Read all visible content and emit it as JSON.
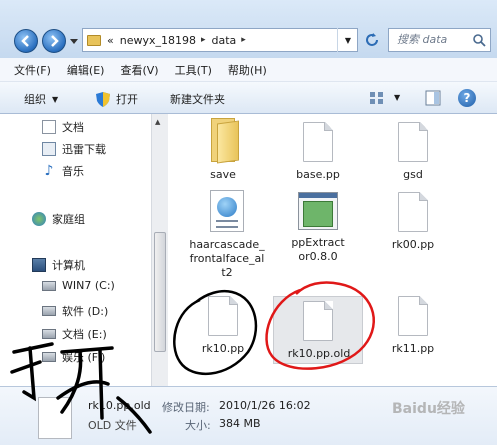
{
  "address": {
    "prefix": "«",
    "path": [
      "newyx_18198",
      "data"
    ],
    "separator": "▸",
    "search_placeholder": "搜索 data"
  },
  "menu": [
    "文件(F)",
    "编辑(E)",
    "查看(V)",
    "工具(T)",
    "帮助(H)"
  ],
  "toolbar": {
    "organize": "组织",
    "open": "打开",
    "new_folder": "新建文件夹",
    "help": "?"
  },
  "nav": {
    "items": [
      {
        "label": "文档",
        "icon": "documents-icon"
      },
      {
        "label": "迅雷下载",
        "icon": "downloads-icon"
      },
      {
        "label": "音乐",
        "icon": "music-icon"
      },
      {
        "label": "家庭组",
        "icon": "homegroup-icon"
      },
      {
        "label": "计算机",
        "icon": "computer-icon"
      },
      {
        "label": "WIN7 (C:)",
        "icon": "drive-icon"
      },
      {
        "label": "软件 (D:)",
        "icon": "drive-icon"
      },
      {
        "label": "文档 (E:)",
        "icon": "drive-icon"
      },
      {
        "label": "娱乐 (F:)",
        "icon": "drive-icon"
      }
    ]
  },
  "files": [
    {
      "name": "save",
      "kind": "folder"
    },
    {
      "name": "base.pp",
      "kind": "doc"
    },
    {
      "name": "gsd",
      "kind": "doc"
    },
    {
      "name": "haarcascade_frontalface_alt2",
      "kind": "xml"
    },
    {
      "name": "ppExtractor0.8.0",
      "kind": "exe"
    },
    {
      "name": "rk00.pp",
      "kind": "doc"
    },
    {
      "name": "rk10.pp",
      "kind": "doc"
    },
    {
      "name": "rk10.pp.old",
      "kind": "doc"
    },
    {
      "name": "rk11.pp",
      "kind": "doc"
    }
  ],
  "details": {
    "name": "rk10.pp.old",
    "type": "OLD 文件",
    "modified_label": "修改日期:",
    "modified_value": "2010/1/26 16:02",
    "size_label": "大小:",
    "size_value": "384 MB"
  },
  "colors": {
    "annotation_black": "#000000",
    "annotation_red": "#e01818",
    "watermark": "#aaaaaa"
  },
  "annotation_text": "打开",
  "watermark": "Baidu经验"
}
